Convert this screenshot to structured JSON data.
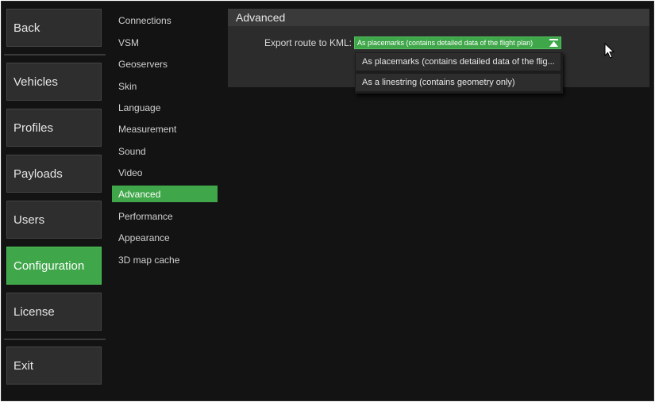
{
  "main_nav": {
    "items": [
      {
        "label": "Back",
        "active": false
      },
      {
        "label": "Vehicles",
        "active": false
      },
      {
        "label": "Profiles",
        "active": false
      },
      {
        "label": "Payloads",
        "active": false
      },
      {
        "label": "Users",
        "active": false
      },
      {
        "label": "Configuration",
        "active": true
      },
      {
        "label": "License",
        "active": false
      },
      {
        "label": "Exit",
        "active": false
      }
    ]
  },
  "sub_nav": {
    "items": [
      {
        "label": "Connections",
        "active": false
      },
      {
        "label": "VSM",
        "active": false
      },
      {
        "label": "Geoservers",
        "active": false
      },
      {
        "label": "Skin",
        "active": false
      },
      {
        "label": "Language",
        "active": false
      },
      {
        "label": "Measurement",
        "active": false
      },
      {
        "label": "Sound",
        "active": false
      },
      {
        "label": "Video",
        "active": false
      },
      {
        "label": "Advanced",
        "active": true
      },
      {
        "label": "Performance",
        "active": false
      },
      {
        "label": "Appearance",
        "active": false
      },
      {
        "label": "3D map cache",
        "active": false
      }
    ]
  },
  "panel": {
    "title": "Advanced",
    "export_kml": {
      "label": "Export route to KML:",
      "selected_value": "As placemarks (contains detailed data of the flight plan)",
      "options": [
        "As placemarks (contains detailed data of the flig...",
        "As a linestring (contains geometry only)"
      ]
    }
  },
  "icons": {
    "dropdown_arrow": "collapse-up-icon",
    "cursor": "mouse-pointer-icon"
  },
  "colors": {
    "background": "#131313",
    "button": "#2e2e2e",
    "accent_green": "#3fa74a",
    "panel": "#2c2c2c",
    "panel_header": "#3a3a3a"
  }
}
